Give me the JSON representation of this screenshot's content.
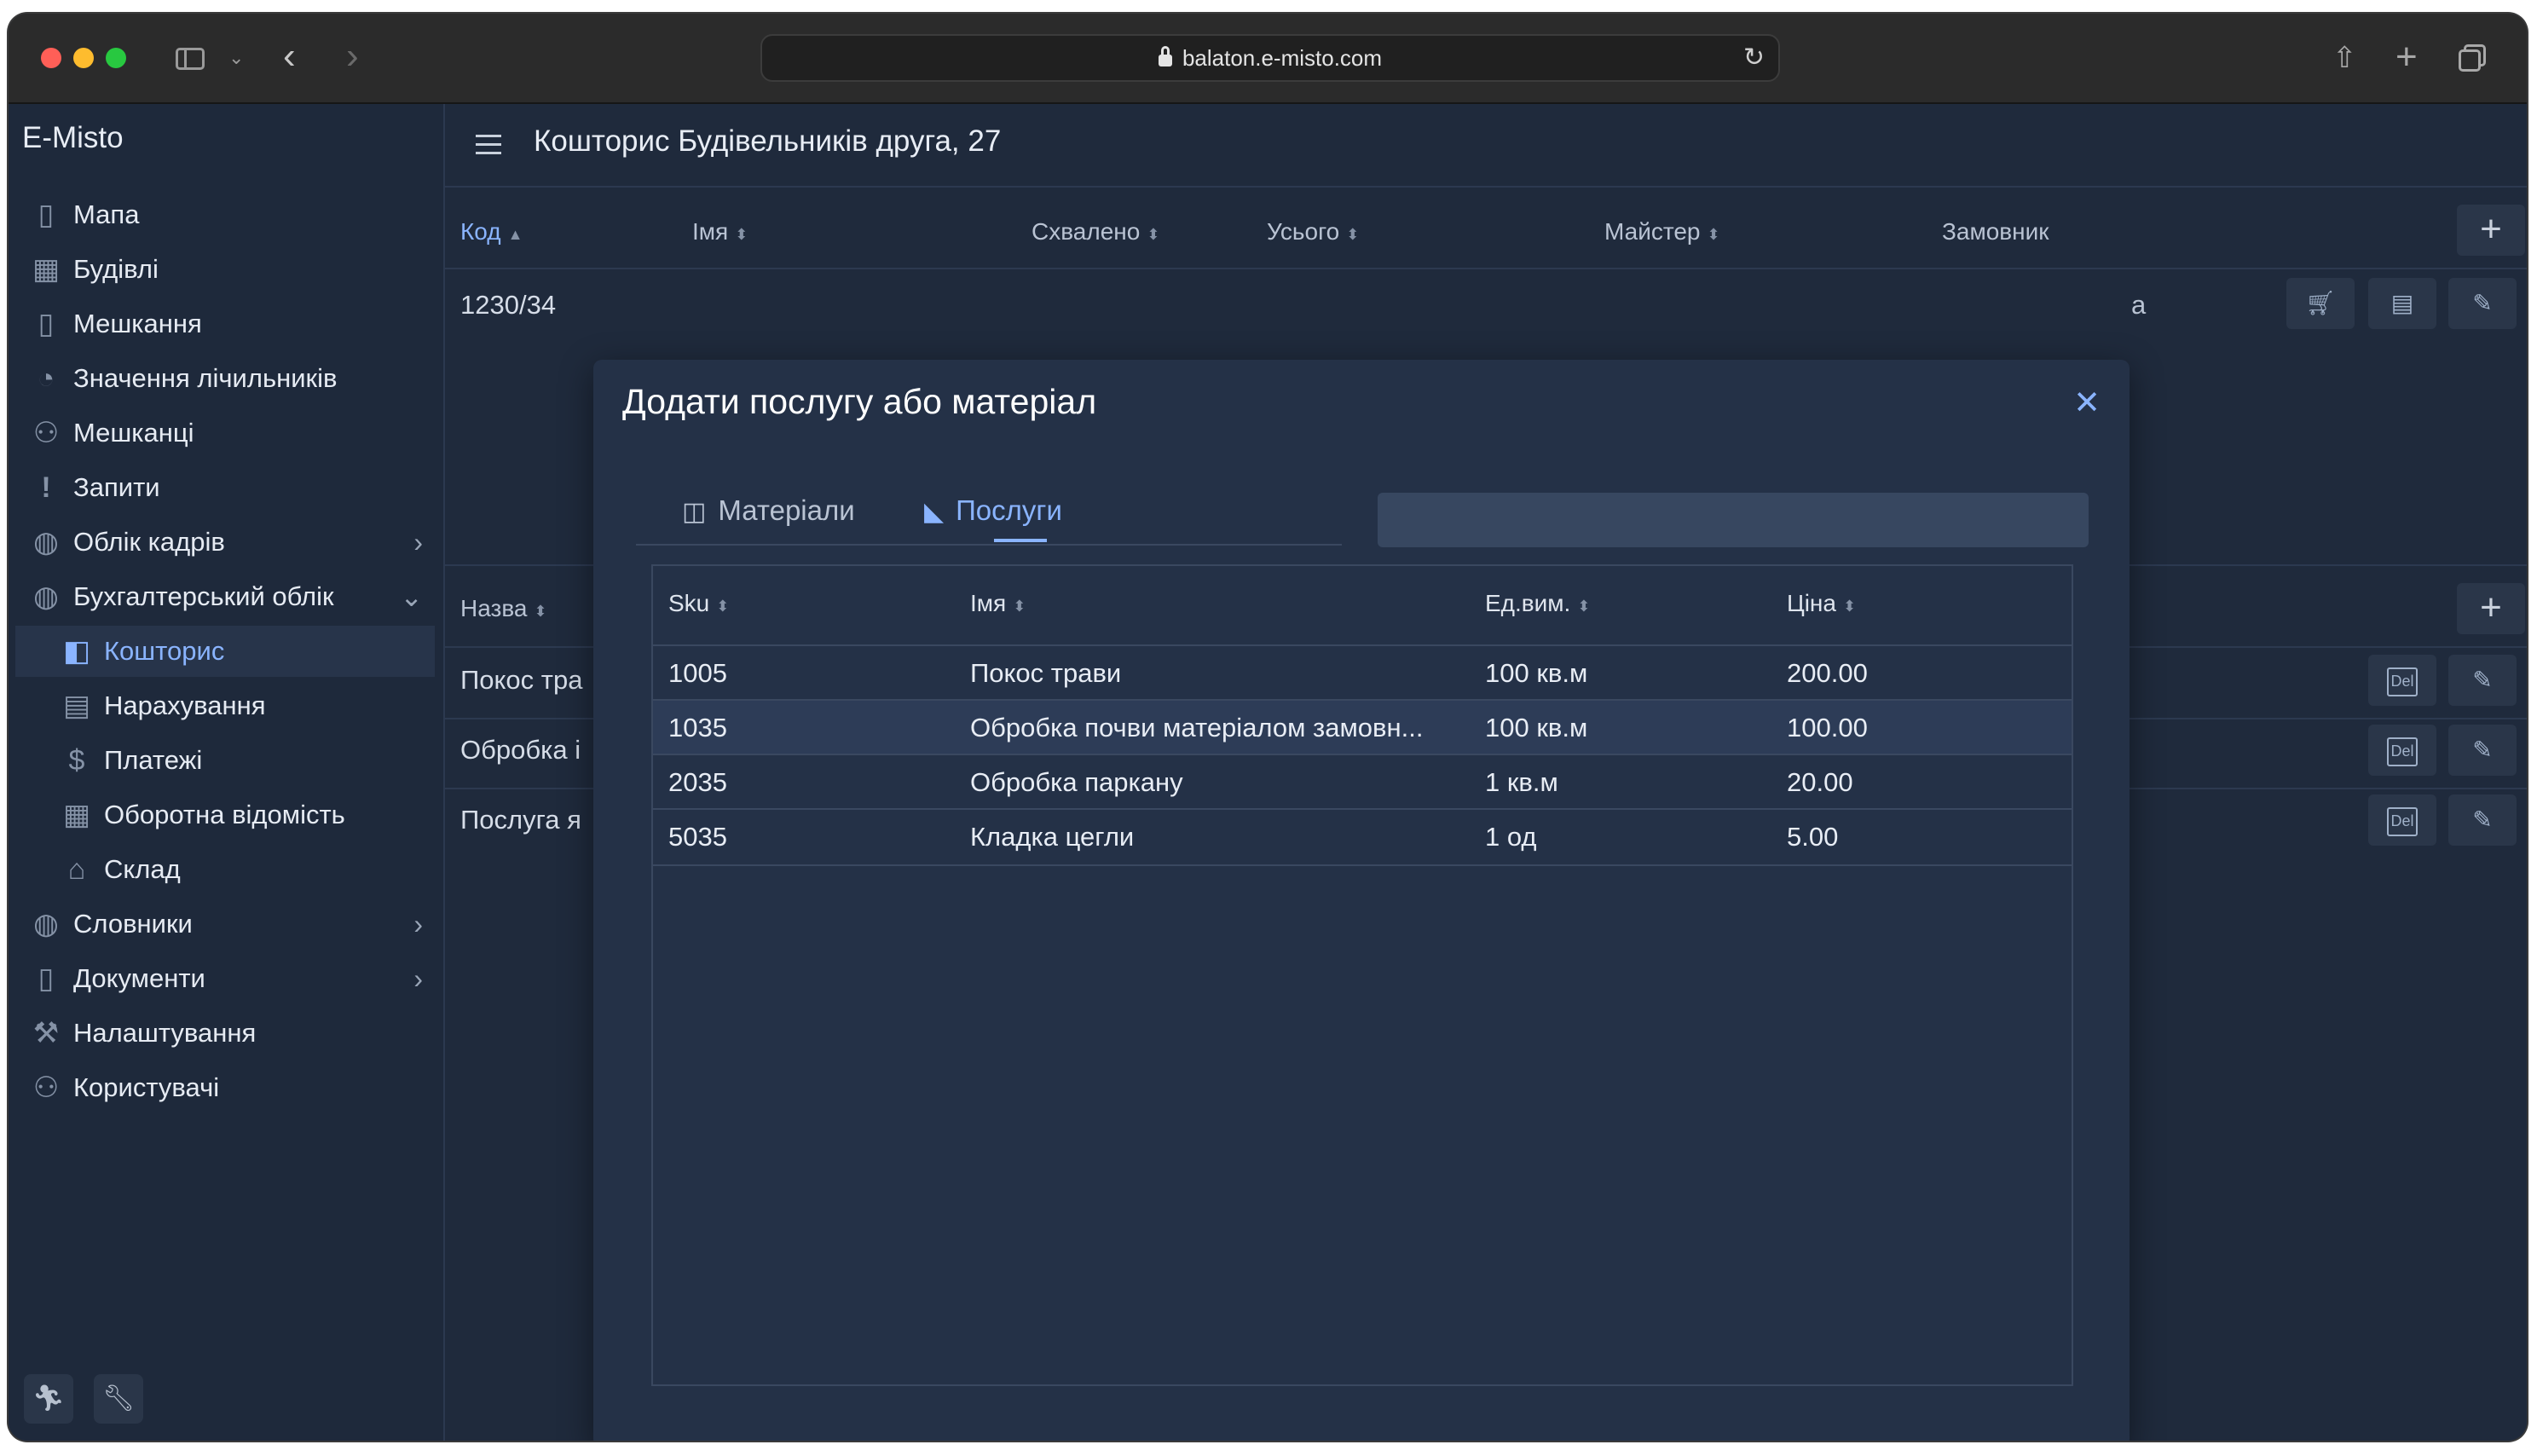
{
  "browser": {
    "url": "balaton.e-misto.com"
  },
  "sidebar": {
    "title": "E-Misto",
    "items": [
      {
        "label": "Мапа",
        "icon": "map-icon"
      },
      {
        "label": "Будівлі",
        "icon": "building-icon"
      },
      {
        "label": "Мешкання",
        "icon": "door-icon"
      },
      {
        "label": "Значення лічильників",
        "icon": "gauge-icon"
      },
      {
        "label": "Мешканці",
        "icon": "people-icon"
      },
      {
        "label": "Запити",
        "icon": "exclamation-icon"
      },
      {
        "label": "Облік кадрів",
        "icon": "globe-icon",
        "expandable": true
      },
      {
        "label": "Бухгалтерський облік",
        "icon": "globe-icon",
        "expanded": true
      },
      {
        "label": "Кошторис",
        "icon": "reader-icon",
        "active": true,
        "sub": true
      },
      {
        "label": "Нарахування",
        "icon": "invoice-icon",
        "sub": true
      },
      {
        "label": "Платежі",
        "icon": "dollar-icon",
        "sub": true
      },
      {
        "label": "Оборотна відомість",
        "icon": "table-icon",
        "sub": true
      },
      {
        "label": "Склад",
        "icon": "warehouse-icon",
        "sub": true
      },
      {
        "label": "Словники",
        "icon": "globe-icon",
        "expandable": true
      },
      {
        "label": "Документи",
        "icon": "document-icon",
        "expandable": true
      },
      {
        "label": "Налаштування",
        "icon": "wrench-icon"
      },
      {
        "label": "Користувачі",
        "icon": "users-icon"
      }
    ]
  },
  "page": {
    "title": "Кошторис Будівельників друга, 27",
    "top_table": {
      "headers": [
        "Код",
        "Імя",
        "Схвалено",
        "Усього",
        "Майстер",
        "Замовник"
      ],
      "row": {
        "code": "1230/34",
        "customer_partial": "а"
      }
    },
    "bottom_table": {
      "header": "Назва",
      "rows": [
        "Покос тра",
        "Обробка і",
        "Послуга я"
      ],
      "delete_label": "Del"
    }
  },
  "modal": {
    "title": "Додати послугу або матеріал",
    "tabs": [
      {
        "label": "Матеріали",
        "icon": "columns-icon"
      },
      {
        "label": "Послуги",
        "icon": "service-icon",
        "active": true
      }
    ],
    "search": {
      "placeholder": "",
      "value": ""
    },
    "grid": {
      "headers": [
        "Sku",
        "Імя",
        "Ед.вим.",
        "Ціна"
      ],
      "rows": [
        {
          "sku": "1005",
          "name": "Покос трави",
          "unit": "100 кв.м",
          "price": "200.00"
        },
        {
          "sku": "1035",
          "name": "Обробка почви матеріалом замовн...",
          "unit": "100 кв.м",
          "price": "100.00",
          "selected": true
        },
        {
          "sku": "2035",
          "name": "Обробка паркану",
          "unit": "1 кв.м",
          "price": "20.00"
        },
        {
          "sku": "5035",
          "name": "Кладка цегли",
          "unit": "1 од",
          "price": "5.00"
        }
      ]
    }
  },
  "colors": {
    "accent": "#8ab4ff",
    "app_bg": "#1f2a3c",
    "sidebar_bg": "#1e293b",
    "modal_bg": "#243147",
    "selected_row": "#2d3c57"
  }
}
